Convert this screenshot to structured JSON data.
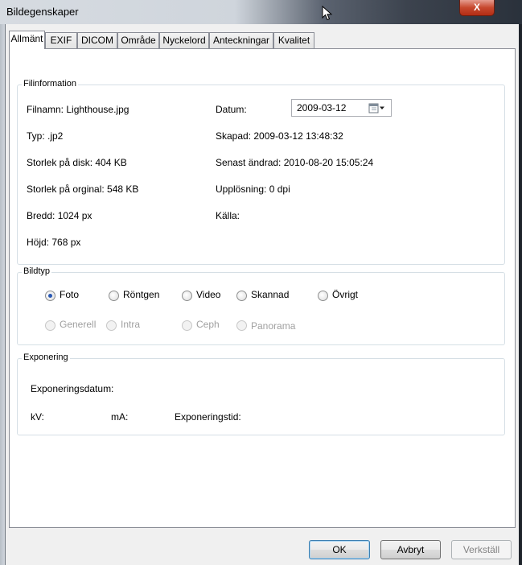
{
  "window": {
    "title": "Bildegenskaper",
    "close_label": "X"
  },
  "tabs": [
    {
      "label": "Allmänt",
      "active": true
    },
    {
      "label": "EXIF"
    },
    {
      "label": "DICOM"
    },
    {
      "label": "Område"
    },
    {
      "label": "Nyckelord"
    },
    {
      "label": "Anteckningar"
    },
    {
      "label": "Kvalitet"
    }
  ],
  "fileinfo": {
    "legend": "Filinformation",
    "filename": "Filnamn: Lighthouse.jpg",
    "type": "Typ: .jp2",
    "size_on_disk": "Storlek på disk: 404 KB",
    "size_original": "Storlek på orginal: 548 KB",
    "width": "Bredd: 1024 px",
    "height": "Höjd: 768 px",
    "date_label": "Datum:",
    "date_value": "2009-03-12",
    "created": "Skapad: 2009-03-12 13:48:32",
    "modified": "Senast ändrad: 2010-08-20 15:05:24",
    "resolution": "Upplösning: 0 dpi",
    "source": "Källa:"
  },
  "imagetype": {
    "legend": "Bildtyp",
    "row1": [
      "Foto",
      "Röntgen",
      "Video",
      "Skannad",
      "Övrigt"
    ],
    "selected": "Foto",
    "row2": [
      "Generell",
      "Intra",
      "Ceph",
      "Panorama"
    ]
  },
  "exposure": {
    "legend": "Exponering",
    "date": "Exponeringsdatum:",
    "kv": "kV:",
    "ma": "mA:",
    "time": "Exponeringstid:"
  },
  "buttons": {
    "ok": "OK",
    "cancel": "Avbryt",
    "apply": "Verkställ"
  },
  "colors": {
    "accent": "#2a59b3",
    "close": "#c7482e"
  }
}
